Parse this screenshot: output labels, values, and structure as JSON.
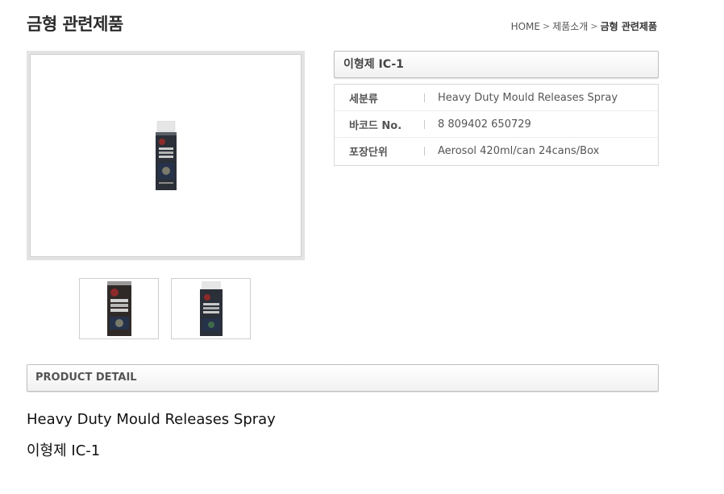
{
  "header": {
    "title": "금형 관련제품",
    "breadcrumb": {
      "home": "HOME",
      "section": "제품소개",
      "current": "금형 관련제품",
      "separator": ">"
    }
  },
  "product": {
    "name": "이형제 IC-1",
    "specs": [
      {
        "label": "세분류",
        "value": "Heavy Duty Mould Releases Spray"
      },
      {
        "label": "바코드 No.",
        "value": "8 809402 650729"
      },
      {
        "label": "포장단위",
        "value": "Aerosol 420ml/can 24cans/Box"
      }
    ]
  },
  "detail": {
    "header": "PRODUCT DETAIL",
    "line1": "Heavy Duty Mould Releases Spray",
    "line2": "이형제 IC-1"
  },
  "colors": {
    "can_body": "#2a2f38",
    "can_cap": "#dcdcdc",
    "can_label_red": "#8c2a2a",
    "can_label_blue": "#26324a"
  }
}
